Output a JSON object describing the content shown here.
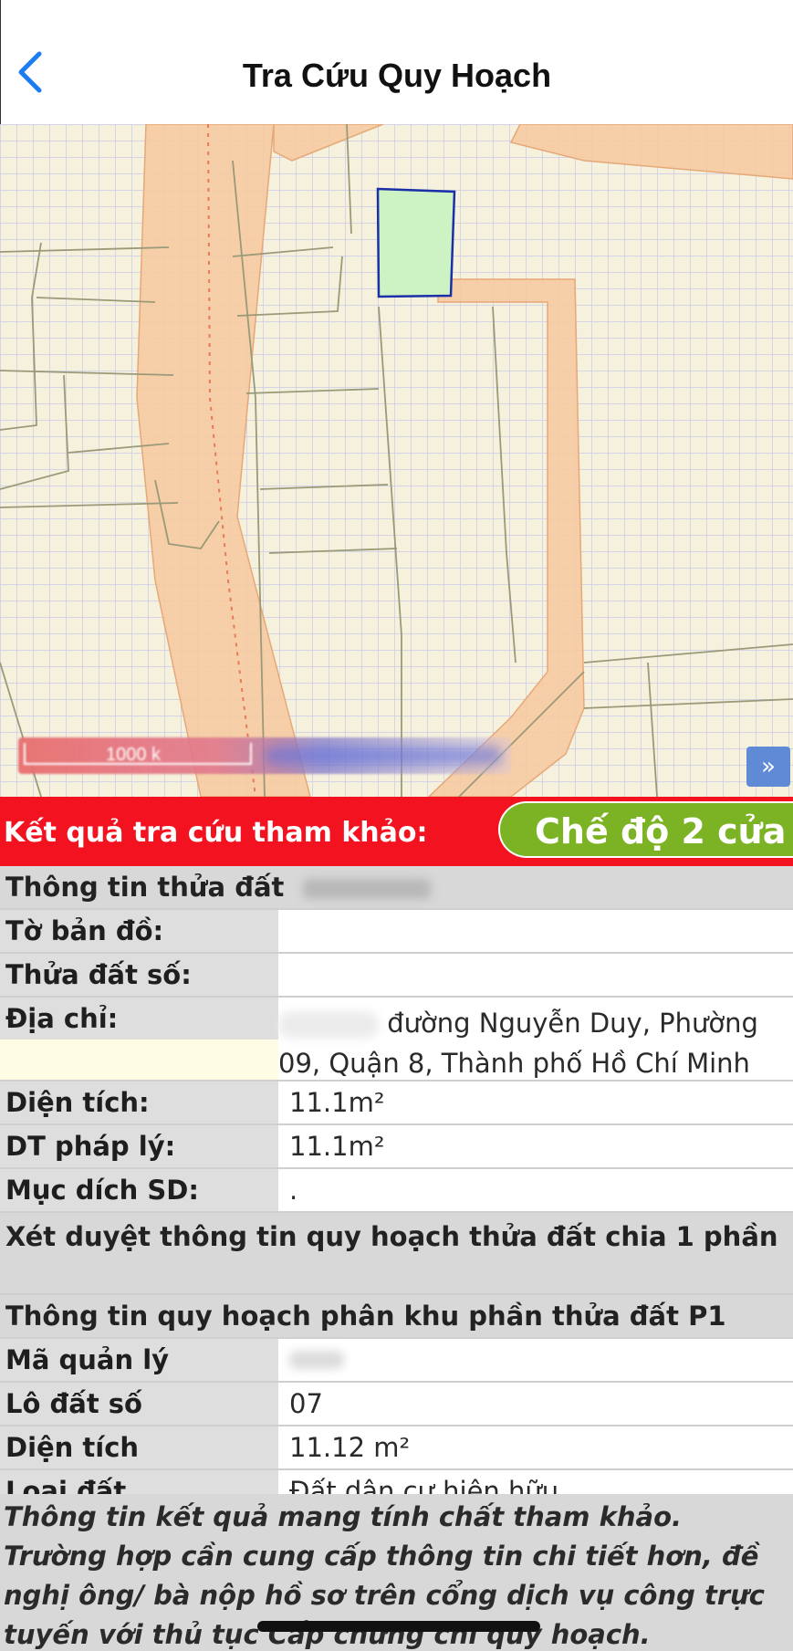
{
  "header": {
    "title": "Tra Cứu Quy Hoạch"
  },
  "map": {
    "scale_label": "1000 k",
    "expand_label": "»"
  },
  "result_bar": {
    "label": "Kết quả tra cứu tham khảo:",
    "mode_button": "Chế độ 2 cửa"
  },
  "parcel": {
    "section_title": "Thông tin thửa đất",
    "rows": [
      {
        "label": "Tờ bản đồ:",
        "value": ""
      },
      {
        "label": "Thửa đất số:",
        "value": ""
      },
      {
        "label": "Địa chỉ:",
        "value": "đường Nguyễn Duy, Phường 09, Quận 8, Thành phố Hồ Chí Minh"
      },
      {
        "label": "Diện tích:",
        "value": "11.1m²"
      },
      {
        "label": "DT pháp lý:",
        "value": "11.1m²"
      },
      {
        "label": "Mục dích SD:",
        "value": "."
      }
    ]
  },
  "review_title": "Xét duyệt thông tin quy hoạch thửa đất chia 1 phần",
  "zoning": {
    "section_title": "Thông tin quy hoạch phân khu phần thửa đất P1",
    "rows": [
      {
        "label": "Mã quản lý",
        "value": ""
      },
      {
        "label": "Lô đất số",
        "value": "07"
      },
      {
        "label": "Diện tích",
        "value": "11.12 m²"
      },
      {
        "label": "Loại đất",
        "value": "Đất dân cư hiện hữu"
      }
    ]
  },
  "note": "Thông tin kết quả mang tính chất tham khảo. Trường hợp cần cung cấp thông tin chi tiết hơn, đề nghị ông/ bà nộp hồ sơ trên cổng dịch vụ công trực tuyến với thủ tục Cấp chứng chỉ quy hoạch.",
  "colors": {
    "accent_red": "#f3121f",
    "mode_green": "#7cb324",
    "road": "#f6c9a0",
    "parcel": "#cdf2c3",
    "parcel_border": "#1a2fa8"
  }
}
